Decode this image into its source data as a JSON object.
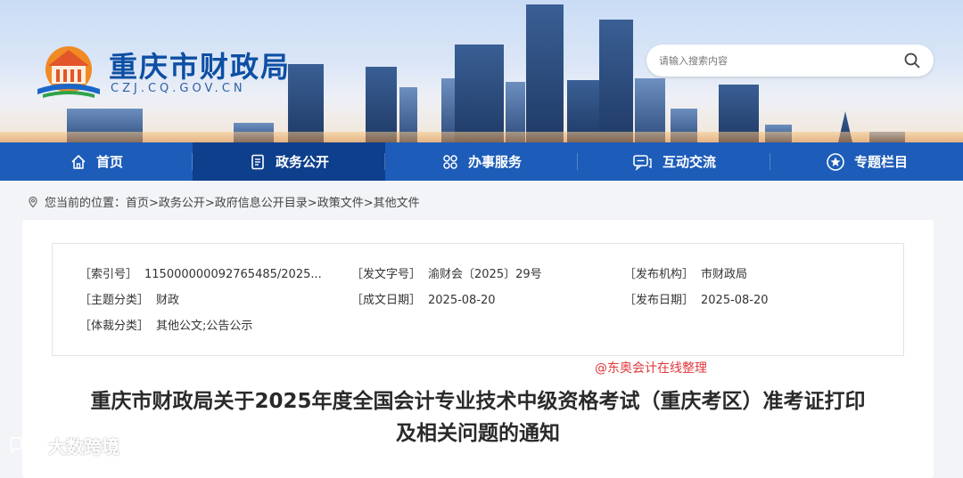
{
  "site": {
    "name": "重庆市财政局",
    "domain": "CZJ.CQ.GOV.CN"
  },
  "search": {
    "placeholder": "请输入搜索内容",
    "icon": "search-icon"
  },
  "nav": {
    "items": [
      {
        "label": "首页",
        "icon": "home-icon"
      },
      {
        "label": "政务公开",
        "icon": "document-icon",
        "active": true
      },
      {
        "label": "办事服务",
        "icon": "grid-icon"
      },
      {
        "label": "互动交流",
        "icon": "chat-icon"
      },
      {
        "label": "专题栏目",
        "icon": "star-icon"
      }
    ]
  },
  "breadcrumb": {
    "prefix": "您当前的位置：",
    "path": "首页>政务公开>政府信息公开目录>政策文件>其他文件"
  },
  "meta": {
    "index_label": "［索引号］",
    "index_value": "115000000092765485/2025...",
    "doc_no_label": "［发文字号］",
    "doc_no_value": "渝财会〔2025〕29号",
    "issuer_label": "［发布机构］",
    "issuer_value": "市财政局",
    "topic_label": "［主题分类］",
    "topic_value": "财政",
    "written_label": "［成文日期］",
    "written_value": "2025-08-20",
    "published_label": "［发布日期］",
    "published_value": "2025-08-20",
    "genre_label": "［体裁分类］",
    "genre_value": "其他公文;公告公示"
  },
  "overlay_note": "@东奥会计在线整理",
  "article": {
    "title_line1": "重庆市财政局关于2025年度全国会计专业技术中级资格考试（重庆考区）准考证打印",
    "title_line2": "及相关问题的通知"
  },
  "watermark": "大数跨境",
  "colors": {
    "nav_bg": "#1d5cb8",
    "nav_active": "#0e3f8c",
    "brand": "#0d4fa3",
    "note_red": "#e0373a"
  }
}
